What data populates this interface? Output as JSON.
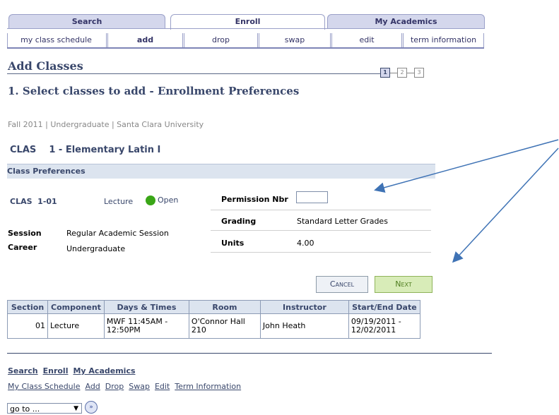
{
  "top_tabs": [
    "Search",
    "Enroll",
    "My Academics"
  ],
  "sub_tabs": [
    "my class schedule",
    "add",
    "drop",
    "swap",
    "edit",
    "term information"
  ],
  "page_title": "Add Classes",
  "steps": [
    "1",
    "2",
    "3"
  ],
  "subheading": "1.  Select classes to add - Enrollment Preferences",
  "term_line": "Fall 2011 | Undergraduate | Santa Clara University",
  "course_title": "CLAS    1 - Elementary Latin I",
  "section_header": "Class Preferences",
  "class": {
    "code": "CLAS  1-01",
    "component": "Lecture",
    "status": "Open",
    "session_label": "Session",
    "session_value": "Regular Academic Session",
    "career_label": "Career",
    "career_value": "Undergraduate"
  },
  "prefs": {
    "permission_label": "Permission Nbr",
    "permission_value": "",
    "grading_label": "Grading",
    "grading_value": "Standard Letter Grades",
    "units_label": "Units",
    "units_value": "4.00"
  },
  "buttons": {
    "cancel": "Cancel",
    "next": "Next"
  },
  "table": {
    "headers": [
      "Section",
      "Component",
      "Days & Times",
      "Room",
      "Instructor",
      "Start/End Date"
    ],
    "row": {
      "section": "01",
      "component": "Lecture",
      "days_1": "MWF 11:45AM -",
      "days_2": "12:50PM",
      "room_1": "O'Connor Hall",
      "room_2": "210",
      "instructor": "John Heath",
      "dates_1": "09/19/2011 -",
      "dates_2": "12/02/2011"
    }
  },
  "footer_links_1": [
    "Search",
    "Enroll",
    "My Academics"
  ],
  "footer_links_2": [
    "My Class Schedule",
    "Add",
    "Drop",
    "Swap",
    "Edit",
    "Term Information"
  ],
  "goto": {
    "value": "go to ...",
    "button_icon": "double-chevron-right-icon"
  },
  "colors": {
    "accent": "#39476b",
    "tab_bg": "#d4d7ec",
    "open_green": "#3aa617",
    "arrow_blue": "#3f73b5"
  }
}
